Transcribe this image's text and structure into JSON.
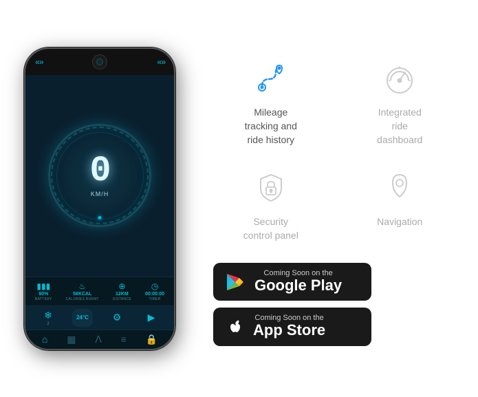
{
  "phone": {
    "chevrons_left": "«»",
    "speedValue": "0",
    "speedUnit": "KM/H",
    "stats": [
      {
        "icon": "🔋",
        "value": "80%",
        "label": "BATTERY"
      },
      {
        "icon": "🔥",
        "value": "56KCAL",
        "label": "CALORIES BURNT"
      },
      {
        "icon": "🗺",
        "value": "12KM",
        "label": "DISTANCE"
      },
      {
        "icon": "⏱",
        "value": "00:00:00",
        "label": "TIMER"
      }
    ],
    "controls": [
      {
        "icon": "❄",
        "label": "2"
      },
      {
        "icon": "🌡",
        "temp": "24°C"
      },
      {
        "icon": "⚙",
        "label": ""
      },
      {
        "icon": "▶",
        "label": ""
      }
    ]
  },
  "features": [
    {
      "id": "mileage",
      "label": "Mileage\ntracking and\nride history",
      "active": true
    },
    {
      "id": "integrated",
      "label": "Integrated\nride\ndashboard",
      "active": false
    },
    {
      "id": "security",
      "label": "Security\ncontrol panel",
      "active": false
    },
    {
      "id": "navigation",
      "label": "Navigation",
      "active": false
    }
  ],
  "stores": [
    {
      "id": "google-play",
      "sub": "Coming Soon on the",
      "title": "Google Play"
    },
    {
      "id": "app-store",
      "sub": "Coming Soon on the",
      "title": "App Store"
    }
  ]
}
